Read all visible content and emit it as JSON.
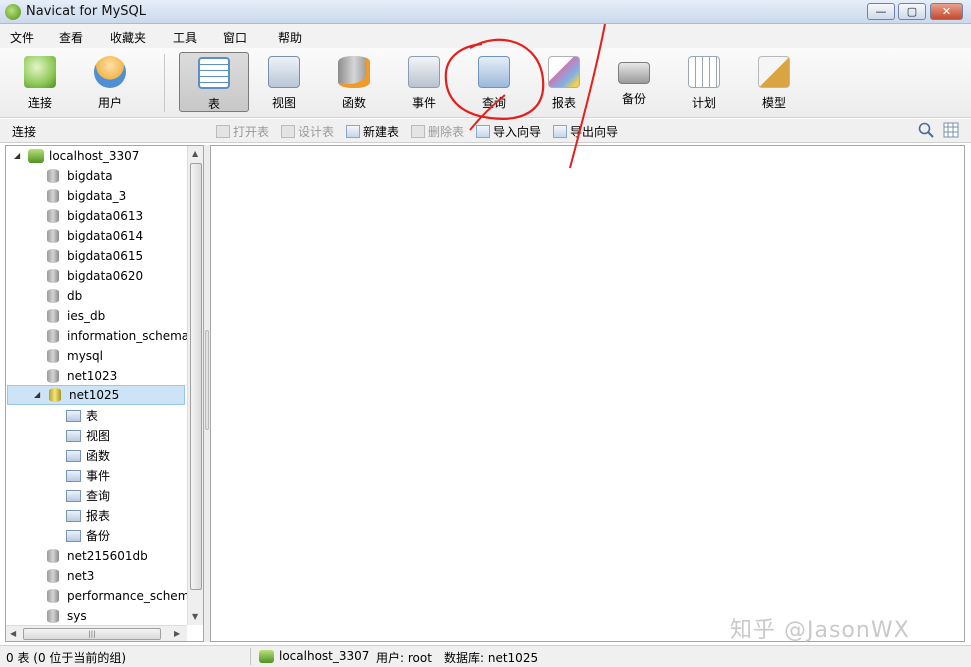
{
  "window": {
    "title": "Navicat for MySQL",
    "min_label": "▭",
    "max_label": "▢",
    "close_label": "✕"
  },
  "menu": [
    "文件",
    "查看",
    "收藏夹",
    "工具",
    "窗口",
    "帮助"
  ],
  "toolbar": [
    {
      "label": "连接",
      "icon": "connection-icon",
      "color": "#8fc95a"
    },
    {
      "label": "用户",
      "icon": "user-icon",
      "color": "#f2b64c"
    },
    {
      "label": "表",
      "icon": "table-icon",
      "color": "#5c8fc8",
      "active": true
    },
    {
      "label": "视图",
      "icon": "view-icon",
      "color": "#7a8fa8"
    },
    {
      "label": "函数",
      "icon": "function-icon",
      "color": "#b28a3c"
    },
    {
      "label": "事件",
      "icon": "event-icon",
      "color": "#8c9bb0"
    },
    {
      "label": "查询",
      "icon": "query-icon",
      "color": "#6d93c0"
    },
    {
      "label": "报表",
      "icon": "report-icon",
      "color": "#c97ab5"
    },
    {
      "label": "备份",
      "icon": "backup-icon",
      "color": "#7d7d7d"
    },
    {
      "label": "计划",
      "icon": "schedule-icon",
      "color": "#9aa6b5"
    },
    {
      "label": "模型",
      "icon": "model-icon",
      "color": "#d9a441"
    }
  ],
  "subbar": {
    "label": "连接",
    "buttons": [
      {
        "label": "打开表",
        "enabled": false
      },
      {
        "label": "设计表",
        "enabled": false
      },
      {
        "label": "新建表",
        "enabled": true
      },
      {
        "label": "删除表",
        "enabled": false
      },
      {
        "label": "导入向导",
        "enabled": true
      },
      {
        "label": "导出向导",
        "enabled": true
      }
    ]
  },
  "tree": {
    "connection": "localhost_3307",
    "databases": [
      "bigdata",
      "bigdata_3",
      "bigdata0613",
      "bigdata0614",
      "bigdata0615",
      "bigdata0620",
      "db",
      "ies_db",
      "information_schema",
      "mysql",
      "net1023"
    ],
    "open_db": "net1025",
    "objects": [
      {
        "label": "表",
        "icon": "table-icon"
      },
      {
        "label": "视图",
        "icon": "view-icon"
      },
      {
        "label": "函数",
        "icon": "function-icon"
      },
      {
        "label": "事件",
        "icon": "event-icon"
      },
      {
        "label": "查询",
        "icon": "query-icon"
      },
      {
        "label": "报表",
        "icon": "report-icon"
      },
      {
        "label": "备份",
        "icon": "backup-icon"
      }
    ],
    "databases_after": [
      "net215601db",
      "net3",
      "performance_schem",
      "sys"
    ]
  },
  "status": {
    "count": "0 表 (0 位于当前的组)",
    "connection": "localhost_3307",
    "user": "用户: root",
    "database": "数据库: net1025"
  },
  "watermark": "知乎 @JasonWX"
}
